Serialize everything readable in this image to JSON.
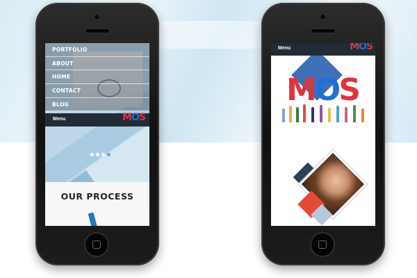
{
  "left_phone": {
    "nav_items": [
      "PORTFOLIO",
      "ABOUT",
      "HOME",
      "CONTACT",
      "BLOG"
    ],
    "menu_label": "Menu",
    "logo": {
      "m": "M",
      "o": "O",
      "s": "S"
    },
    "slider": {
      "dots": 4,
      "active_index": 3
    },
    "section_title": "OUR PROCESS"
  },
  "right_phone": {
    "menu_label": "Menu",
    "logo": {
      "m": "M",
      "o": "O",
      "s": "S"
    },
    "hero_logo": {
      "m": "M",
      "o": "O",
      "s": "S"
    }
  },
  "colors": {
    "brand_red": "#e0343b",
    "brand_blue": "#1e6fd9",
    "menu_bar": "#222c36",
    "accent_dot": "#4db1e0"
  }
}
